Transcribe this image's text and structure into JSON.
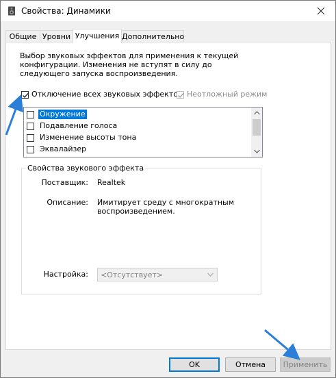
{
  "window": {
    "title": "Свойства: Динамики"
  },
  "tabs": [
    {
      "label": "Общие"
    },
    {
      "label": "Уровни"
    },
    {
      "label": "Улучшения"
    },
    {
      "label": "Дополнительно"
    }
  ],
  "enhancements": {
    "description": "Выбор звуковых эффектов для применения к текущей конфигурации. Изменения не вступят в силу до следующего запуска воспроизведения.",
    "disable_all_label": "Отключение всех звуковых эффектов",
    "disable_all_checked": true,
    "immediate_mode_label": "Неотложный режим",
    "immediate_mode_checked": true,
    "effects": [
      {
        "label": "Окружение",
        "checked": false,
        "selected": true
      },
      {
        "label": "Подавление голоса",
        "checked": false,
        "selected": false
      },
      {
        "label": "Изменение высоты тона",
        "checked": false,
        "selected": false
      },
      {
        "label": "Эквалайзер",
        "checked": false,
        "selected": false
      }
    ],
    "properties": {
      "group_title": "Свойства звукового эффекта",
      "provider_label": "Поставщик:",
      "provider_value": "Realtek",
      "description_label": "Описание:",
      "description_value": "Имитирует среду с многократным воспроизведением.",
      "setting_label": "Настройка:",
      "setting_value": "<Отсутствует>"
    }
  },
  "buttons": {
    "ok": "OK",
    "cancel": "Отмена",
    "apply": "Применить"
  },
  "colors": {
    "accent": "#0078d7",
    "annotation_arrow": "#2b7fd8"
  }
}
